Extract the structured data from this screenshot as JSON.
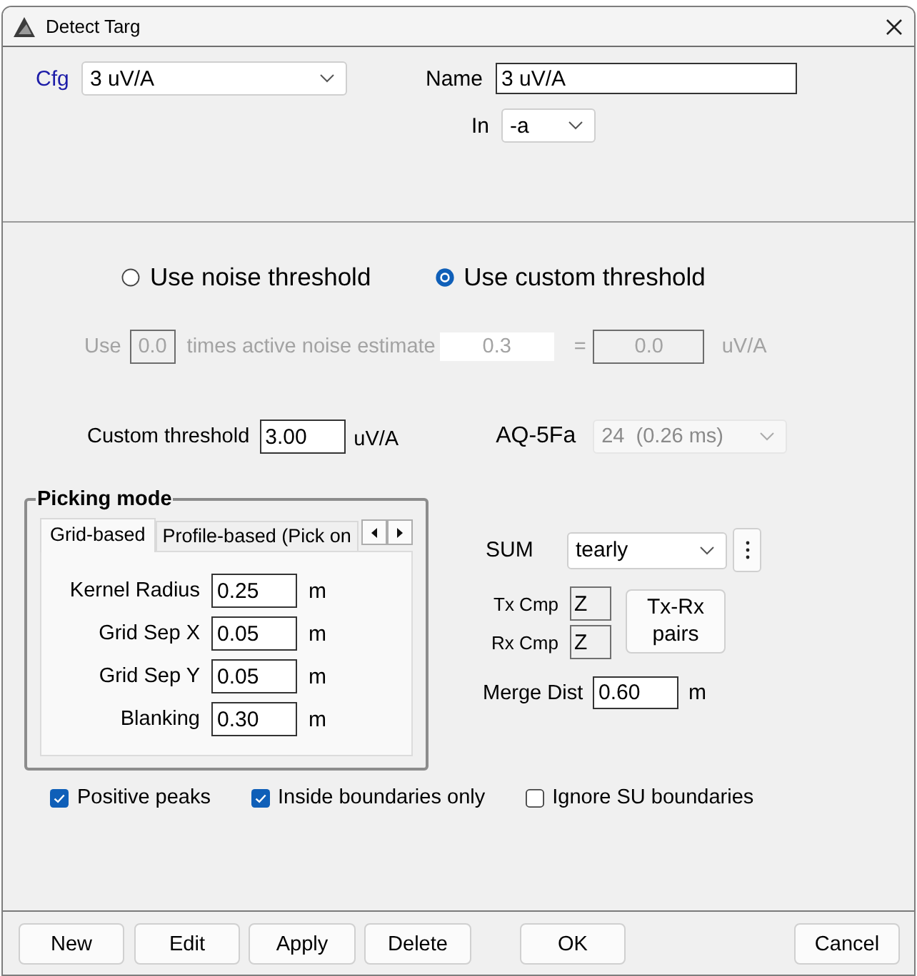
{
  "window": {
    "title": "Detect Targ"
  },
  "config": {
    "cfg_label": "Cfg",
    "cfg_value": "3 uV/A",
    "name_label": "Name",
    "name_value": "3 uV/A",
    "in_label": "In",
    "in_value": "-a"
  },
  "threshold_modes": [
    {
      "label": "Use noise threshold",
      "selected": false
    },
    {
      "label": "Use custom threshold",
      "selected": true
    }
  ],
  "noise_row": {
    "disabled": true,
    "use_label": "Use",
    "factor": "0.0",
    "times_label": "times active noise estimate",
    "estimate": "0.3",
    "equals": "=",
    "result": "0.0",
    "unit": "uV/A"
  },
  "custom_threshold": {
    "label": "Custom threshold",
    "value": "3.00",
    "unit": "uV/A"
  },
  "aq": {
    "label": "AQ-5Fa",
    "value": "24  (0.26 ms)",
    "disabled": true
  },
  "picking_mode": {
    "title": "Picking mode",
    "tabs": [
      {
        "label": "Grid-based",
        "selected": true
      },
      {
        "label": "Profile-based (Pick on",
        "selected": false
      }
    ],
    "fields": [
      {
        "label": "Kernel Radius",
        "value": "0.25",
        "unit": "m"
      },
      {
        "label": "Grid Sep X",
        "value": "0.05",
        "unit": "m"
      },
      {
        "label": "Grid Sep Y",
        "value": "0.05",
        "unit": "m"
      },
      {
        "label": "Blanking",
        "value": "0.30",
        "unit": "m"
      }
    ]
  },
  "sum": {
    "label": "SUM",
    "value": "tearly"
  },
  "components": [
    {
      "label": "Tx Cmp",
      "value": "Z"
    },
    {
      "label": "Rx Cmp",
      "value": "Z"
    }
  ],
  "pairs_button": "Tx-Rx pairs",
  "merge_dist": {
    "label": "Merge Dist",
    "value": "0.60",
    "unit": "m"
  },
  "options": [
    {
      "label": "Positive peaks",
      "checked": true
    },
    {
      "label": "Inside boundaries only",
      "checked": true
    },
    {
      "label": "Ignore SU boundaries",
      "checked": false
    }
  ],
  "footer": {
    "left_buttons": [
      "New",
      "Edit",
      "Apply",
      "Delete"
    ],
    "ok": "OK",
    "cancel": "Cancel"
  }
}
